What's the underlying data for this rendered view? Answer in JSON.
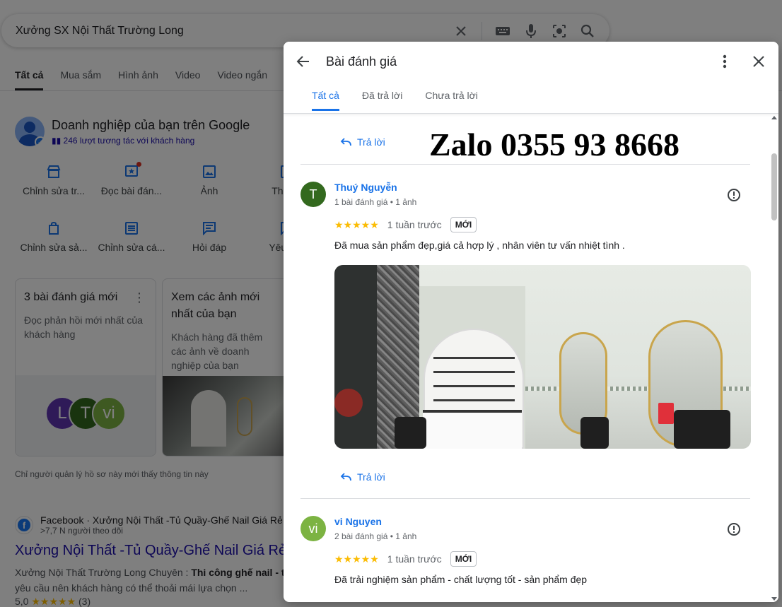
{
  "search": {
    "query": "Xưởng SX Nội Thất Trường Long"
  },
  "search_tabs": [
    {
      "label": "Tất cả",
      "active": true
    },
    {
      "label": "Mua sắm"
    },
    {
      "label": "Hình ảnh"
    },
    {
      "label": "Video"
    },
    {
      "label": "Video ngắn"
    }
  ],
  "business_panel": {
    "title": "Doanh nghiệp của bạn trên Google",
    "interactions": "246 lượt tương tác với khách hàng",
    "actions": [
      {
        "label": "Chỉnh sửa tr...",
        "icon": "store-icon"
      },
      {
        "label": "Đọc bài đán...",
        "icon": "review-star-icon"
      },
      {
        "label": "Ảnh",
        "icon": "photo-icon"
      },
      {
        "label": "Thêm t",
        "icon": "add-icon"
      },
      {
        "label": "Chỉnh sửa sả...",
        "icon": "shopping-bag-icon"
      },
      {
        "label": "Chỉnh sửa cá...",
        "icon": "list-icon"
      },
      {
        "label": "Hỏi đáp",
        "icon": "chat-icon"
      },
      {
        "label": "Yêu cầu",
        "icon": "request-icon"
      }
    ],
    "card_reviews": {
      "title": "3 bài đánh giá mới",
      "desc": "Đọc phản hồi mới nhất của khách hàng",
      "avatars": [
        {
          "letter": "L",
          "color": "#5e35b1"
        },
        {
          "letter": "T",
          "color": "#33691e"
        },
        {
          "letter": "vi",
          "color": "#7cb342"
        }
      ]
    },
    "card_photos": {
      "title": "Xem các ảnh mới nhất của bạn",
      "desc": "Khách hàng đã thêm các ảnh về doanh nghiệp của bạn"
    },
    "owner_note": "Chỉ người quản lý hồ sơ này mới thấy thông tin này"
  },
  "facebook_result": {
    "source": "Facebook · Xưởng Nội Thất -Tủ Quầy-Ghế Nail Giá Rẻ",
    "followers": ">7,7 N người theo dõi",
    "title": "Xưởng Nội Thất -Tủ Quầy-Ghế Nail Giá Rẻ",
    "snippet_prefix": "Xưởng Nội Thất Trường Long Chuyên : ",
    "snippet_bold": "Thi công ghế nail - t",
    "snippet_line2": "yêu cầu nên khách hàng có thể thoải mái lựa chọn ...",
    "rating": "5,0",
    "stars": "★★★★★",
    "rating_count": "(3)"
  },
  "dialog": {
    "title": "Bài đánh giá",
    "tabs": [
      {
        "label": "Tất cả",
        "active": true
      },
      {
        "label": "Đã trả lời"
      },
      {
        "label": "Chưa trả lời"
      }
    ],
    "reply_label": "Trả lời",
    "watermark": "Zalo 0355 93 8668",
    "reviews": [
      {
        "avatar_letter": "T",
        "avatar_color": "#33691e",
        "name": "Thuý Nguyễn",
        "meta": "1 bài đánh giá • 1 ảnh",
        "stars": "★★★★★",
        "time": "1 tuần trước",
        "badge": "MỚI",
        "text": "Đã mua sản phẩm đẹp,giá cả hợp lý , nhân viên tư vấn nhiệt tình ."
      },
      {
        "avatar_letter": "vi",
        "avatar_color": "#7cb342",
        "name": "vi Nguyen",
        "meta": "2 bài đánh giá • 1 ảnh",
        "stars": "★★★★★",
        "time": "1 tuần trước",
        "badge": "MỚI",
        "text": "Đã trải nghiệm sản phẩm - chất lượng tốt - sản phẩm đẹp"
      }
    ]
  }
}
